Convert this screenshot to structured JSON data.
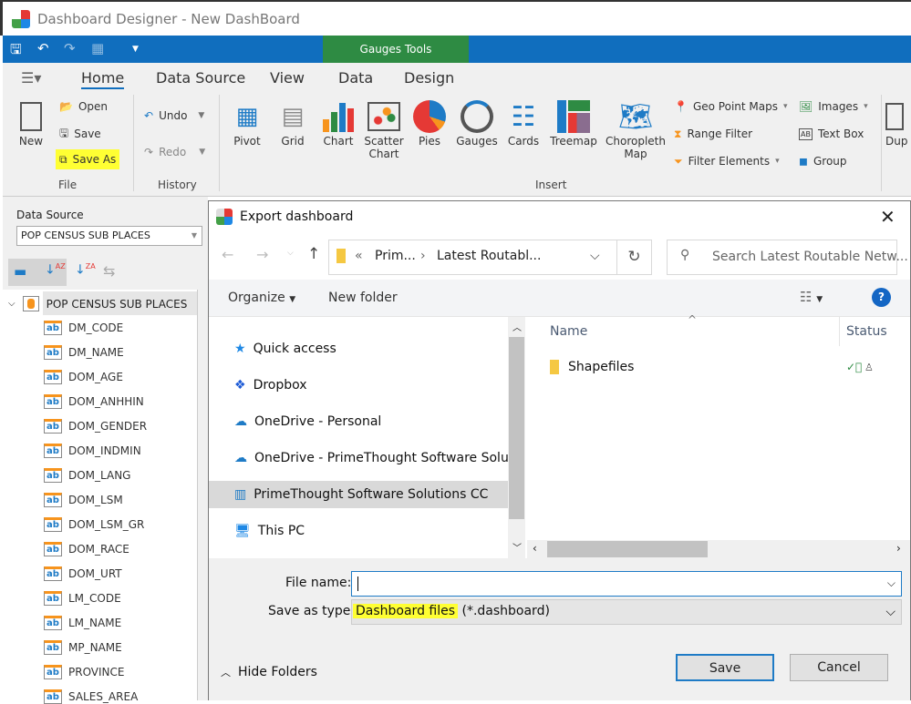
{
  "app": {
    "title": "Dashboard Designer - New DashBoard",
    "context_tab": "Gauges Tools"
  },
  "ribbon": {
    "tabs": [
      "Home",
      "Data Source",
      "View",
      "Data",
      "Design"
    ],
    "file": {
      "new": "New",
      "open": "Open",
      "save": "Save",
      "save_as": "Save As",
      "group": "File"
    },
    "history": {
      "undo": "Undo",
      "redo": "Redo",
      "group": "History"
    },
    "insert": {
      "items": [
        "Pivot",
        "Grid",
        "Chart",
        "Scatter Chart",
        "Pies",
        "Gauges",
        "Cards",
        "Treemap",
        "Choropleth Map"
      ],
      "geo": "Geo Point Maps",
      "range": "Range Filter",
      "filter": "Filter Elements",
      "images": "Images",
      "textbox": "Text Box",
      "group_btn": "Group",
      "duplicate": "Dup",
      "group": "Insert"
    }
  },
  "left": {
    "data_source_label": "Data Source",
    "data_source_value": "POP CENSUS SUB PLACES",
    "root": "POP CENSUS SUB PLACES",
    "fields": [
      "DM_CODE",
      "DM_NAME",
      "DOM_AGE",
      "DOM_ANHHIN",
      "DOM_GENDER",
      "DOM_INDMIN",
      "DOM_LANG",
      "DOM_LSM",
      "DOM_LSM_GR",
      "DOM_RACE",
      "DOM_URT",
      "LM_CODE",
      "LM_NAME",
      "MP_NAME",
      "PROVINCE",
      "SALES_AREA"
    ]
  },
  "dialog": {
    "title": "Export dashboard",
    "breadcrumb": [
      "Prim...",
      "Latest Routabl..."
    ],
    "search_placeholder": "Search Latest Routable Netw...",
    "organize": "Organize",
    "new_folder": "New folder",
    "nav": [
      "Quick access",
      "Dropbox",
      "OneDrive - Personal",
      "OneDrive - PrimeThought Software Solutions CC",
      "PrimeThought Software Solutions CC",
      "This PC"
    ],
    "columns": {
      "name": "Name",
      "status": "Status"
    },
    "files": [
      {
        "name": "Shapefiles",
        "status": "synced"
      }
    ],
    "file_name_label": "File name:",
    "file_name_value": "",
    "save_type_label": "Save as type:",
    "save_type_highlight": "Dashboard files",
    "save_type_rest": " (*.dashboard)",
    "hide_folders": "Hide Folders",
    "save": "Save",
    "cancel": "Cancel"
  },
  "colors": {
    "accent": "#106ebe",
    "context": "#2e8b43",
    "highlight": "#ffff33"
  }
}
